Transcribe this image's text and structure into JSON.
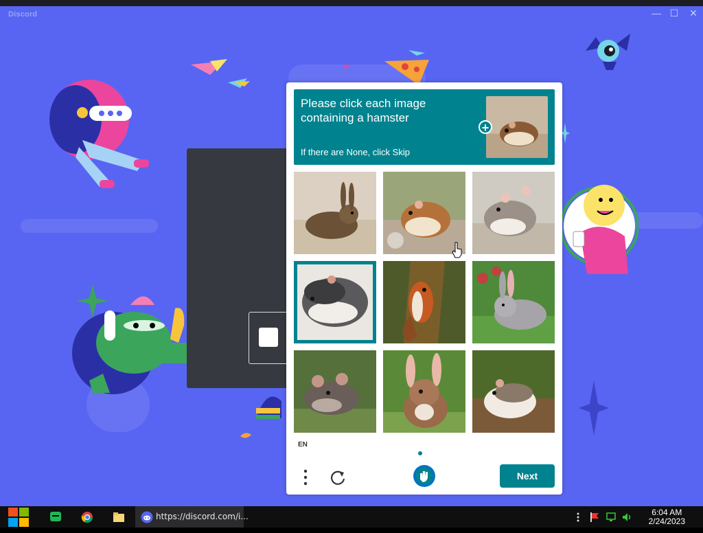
{
  "window": {
    "brand": "Discord",
    "controls": {
      "minimize": "—",
      "maximize": "☐",
      "close": "✕"
    }
  },
  "captcha": {
    "prompt_title": "Please click each image containing a hamster",
    "prompt_sub": "If there are None, click Skip",
    "tiles": [
      {
        "subject": "rabbit",
        "selected": false
      },
      {
        "subject": "hamster",
        "selected": false
      },
      {
        "subject": "hamster",
        "selected": false
      },
      {
        "subject": "hamster",
        "selected": true
      },
      {
        "subject": "squirrel",
        "selected": false
      },
      {
        "subject": "rabbit",
        "selected": false
      },
      {
        "subject": "mouse",
        "selected": false
      },
      {
        "subject": "rabbit",
        "selected": false
      },
      {
        "subject": "hamster",
        "selected": false
      }
    ],
    "language": "EN",
    "next_label": "Next",
    "accent_color": "#00838f"
  },
  "taskbar": {
    "url_text": "https://discord.com/i...",
    "time": "6:04 AM",
    "date": "2/24/2023"
  }
}
